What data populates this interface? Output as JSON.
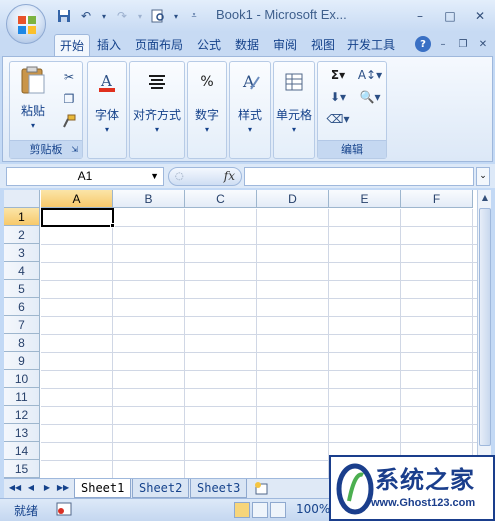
{
  "window": {
    "title": "Book1 - Microsoft Ex...",
    "minimize": "–",
    "maximize": "□",
    "close": "✕"
  },
  "tabs": [
    "开始",
    "插入",
    "页面布局",
    "公式",
    "数据",
    "审阅",
    "视图",
    "开发工具"
  ],
  "active_tab": "开始",
  "ribbon": {
    "clipboard": {
      "paste_label": "粘贴",
      "group_label": "剪贴板"
    },
    "font_label": "字体",
    "alignment_label": "对齐方式",
    "number_label": "数字",
    "styles_label": "样式",
    "cells_label": "单元格",
    "editing_label": "编辑",
    "number_symbol": "%"
  },
  "formula_bar": {
    "name_box": "A1",
    "fx": "fx",
    "formula": ""
  },
  "grid": {
    "columns": [
      "A",
      "B",
      "C",
      "D",
      "E",
      "F"
    ],
    "rows": [
      "1",
      "2",
      "3",
      "4",
      "5",
      "6",
      "7",
      "8",
      "9",
      "10",
      "11",
      "12",
      "13",
      "14",
      "15"
    ],
    "active_cell": "A1"
  },
  "sheets": [
    "Sheet1",
    "Sheet2",
    "Sheet3"
  ],
  "active_sheet": "Sheet1",
  "status": {
    "ready": "就绪",
    "zoom": "100%"
  },
  "watermark": {
    "title": "系统之家",
    "url": "www.Ghost123.com"
  },
  "colors": {
    "accent": "#15428b",
    "ribbon_bg": "#dce8f7",
    "selected_header": "#f7c96b"
  }
}
